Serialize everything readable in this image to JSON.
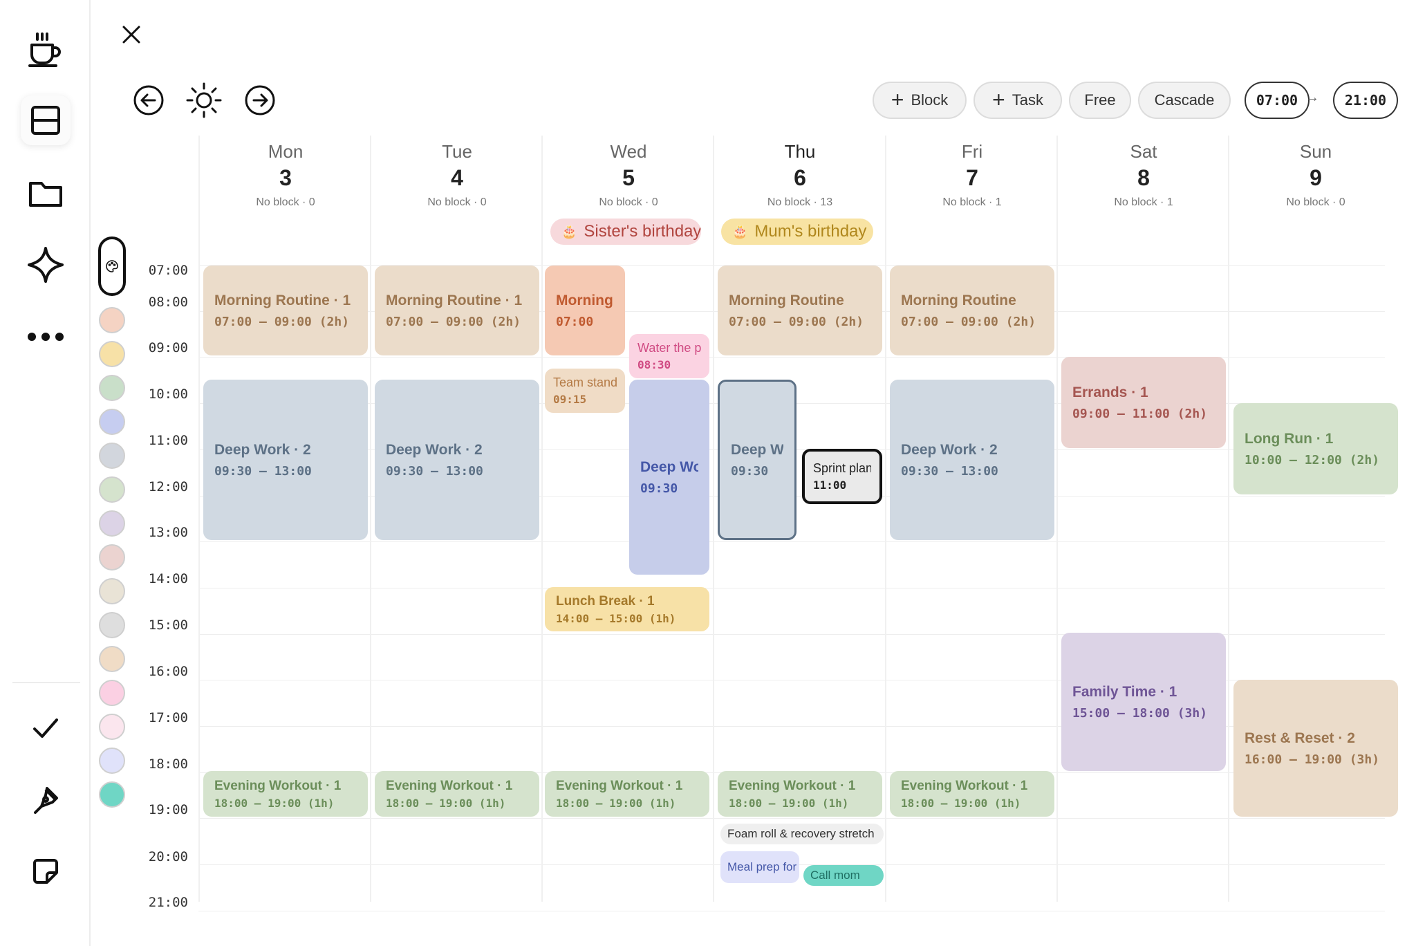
{
  "rail": {
    "icons": [
      "coffee-icon",
      "layout-icon",
      "folder-icon",
      "sparkle-icon",
      "more-icon",
      "check-icon",
      "pen-icon",
      "sticky-note-icon"
    ]
  },
  "toolbar": {
    "block_label": "Block",
    "task_label": "Task",
    "free_label": "Free",
    "cascade_label": "Cascade",
    "start_time": "07:00",
    "arrow": "→",
    "end_time": "21:00"
  },
  "time_labels": [
    "07:00",
    "08:00",
    "09:00",
    "10:00",
    "11:00",
    "12:00",
    "13:00",
    "14:00",
    "15:00",
    "16:00",
    "17:00",
    "18:00",
    "19:00",
    "20:00",
    "21:00"
  ],
  "palette": [
    "#f5d3c3",
    "#f7e1a7",
    "#c9dfc9",
    "#c6cdf0",
    "#d2d6dd",
    "#d5e3cd",
    "#dcd3e6",
    "#ebd3d0",
    "#e9e3d6",
    "#dedede",
    "#f0dcc6",
    "#fbd0e3",
    "#fbe6ee",
    "#e0e2fa",
    "#6fd6c5"
  ],
  "days": [
    {
      "name": "Mon",
      "date": "3",
      "sub": "No block · 0"
    },
    {
      "name": "Tue",
      "date": "4",
      "sub": "No block · 0"
    },
    {
      "name": "Wed",
      "date": "5",
      "sub": "No block · 0"
    },
    {
      "name": "Thu",
      "date": "6",
      "sub": "No block · 13"
    },
    {
      "name": "Fri",
      "date": "7",
      "sub": "No block · 1"
    },
    {
      "name": "Sat",
      "date": "8",
      "sub": "No block · 1"
    },
    {
      "name": "Sun",
      "date": "9",
      "sub": "No block · 0"
    }
  ],
  "birthdays": [
    {
      "label": "Sister's birthday",
      "bg": "#f7d9dc",
      "color": "#b1453f"
    },
    {
      "label": "Mum's birthday",
      "bg": "#f8e3a3",
      "color": "#b0871c"
    }
  ],
  "events": [
    {
      "title": "Morning Routine · 1",
      "time": "07:00 – 09:00 (2h)",
      "bg": "#ebdcca",
      "color": "#9c7650"
    },
    {
      "title": "Morning Routine · 1",
      "time": "07:00 – 09:00 (2h)",
      "bg": "#ebdcca",
      "color": "#9c7650"
    },
    {
      "title": "Morning Routine",
      "time": "07:00",
      "bg": "#f5c9b3",
      "color": "#c05a30"
    },
    {
      "title": "Water the plants",
      "time": "08:30",
      "bg": "#fbd3e2",
      "color": "#d04b83"
    },
    {
      "title": "Team standup",
      "time": "09:15",
      "bg": "#f0dcc6",
      "color": "#b47a45"
    },
    {
      "title": "Deep Work",
      "time": "09:30",
      "bg": "#c6cdea",
      "color": "#4558a8"
    },
    {
      "title": "Lunch Break · 1",
      "time": "14:00 – 15:00 (1h)",
      "bg": "#f7e1a7",
      "color": "#a5792a"
    },
    {
      "title": "Morning Routine",
      "time": "07:00 – 09:00 (2h)",
      "bg": "#ebdcca",
      "color": "#9c7650"
    },
    {
      "title": "Deep Work",
      "time": "09:30",
      "bg": "#d0d9e2",
      "color": "#5d7186"
    },
    {
      "title": "Sprint planning",
      "time": "11:00",
      "bg": "#eaeaea",
      "color": "#222"
    },
    {
      "title": "Morning Routine",
      "time": "07:00 – 09:00 (2h)",
      "bg": "#ebdcca",
      "color": "#9c7650"
    },
    {
      "title": "Deep Work · 2",
      "time": "09:30 – 13:00",
      "bg": "#d0d9e2",
      "color": "#5d7186"
    },
    {
      "title": "Deep Work · 2",
      "time": "09:30 – 13:00",
      "bg": "#d0d9e2",
      "color": "#5d7186"
    },
    {
      "title": "Deep Work · 2",
      "time": "09:30 – 13:00",
      "bg": "#d0d9e2",
      "color": "#5d7186"
    },
    {
      "title": "Errands · 1",
      "time": "09:00 – 11:00 (2h)",
      "bg": "#ebd3d0",
      "color": "#a55651"
    },
    {
      "title": "Family Time · 1",
      "time": "15:00 – 18:00 (3h)",
      "bg": "#dcd3e6",
      "color": "#6f5596"
    },
    {
      "title": "Long Run · 1",
      "time": "10:00 – 12:00 (2h)",
      "bg": "#d5e3cd",
      "color": "#6b8e5a"
    },
    {
      "title": "Rest & Reset · 2",
      "time": "16:00 – 19:00 (3h)",
      "bg": "#ebdcca",
      "color": "#9c7650"
    },
    {
      "title": "Evening Workout · 1",
      "time": "18:00 – 19:00 (1h)",
      "bg": "#d5e3cd",
      "color": "#6b8e5a"
    },
    {
      "title": "Evening Workout · 1",
      "time": "18:00 – 19:00 (1h)",
      "bg": "#d5e3cd",
      "color": "#6b8e5a"
    },
    {
      "title": "Evening Workout · 1",
      "time": "18:00 – 19:00 (1h)",
      "bg": "#d5e3cd",
      "color": "#6b8e5a"
    },
    {
      "title": "Evening Workout · 1",
      "time": "18:00 – 19:00 (1h)",
      "bg": "#d5e3cd",
      "color": "#6b8e5a"
    },
    {
      "title": "Evening Workout · 1",
      "time": "18:00 – 19:00 (1h)",
      "bg": "#d5e3cd",
      "color": "#6b8e5a"
    }
  ],
  "tasks": [
    {
      "label": "Foam roll & recovery stretch",
      "bg": "#efefef",
      "color": "#333"
    },
    {
      "label": "Meal prep for week",
      "bg": "#e0e2fa",
      "color": "#4558a8"
    },
    {
      "label": "Call mom",
      "bg": "#6fd6c5",
      "color": "#1f6f63"
    }
  ]
}
